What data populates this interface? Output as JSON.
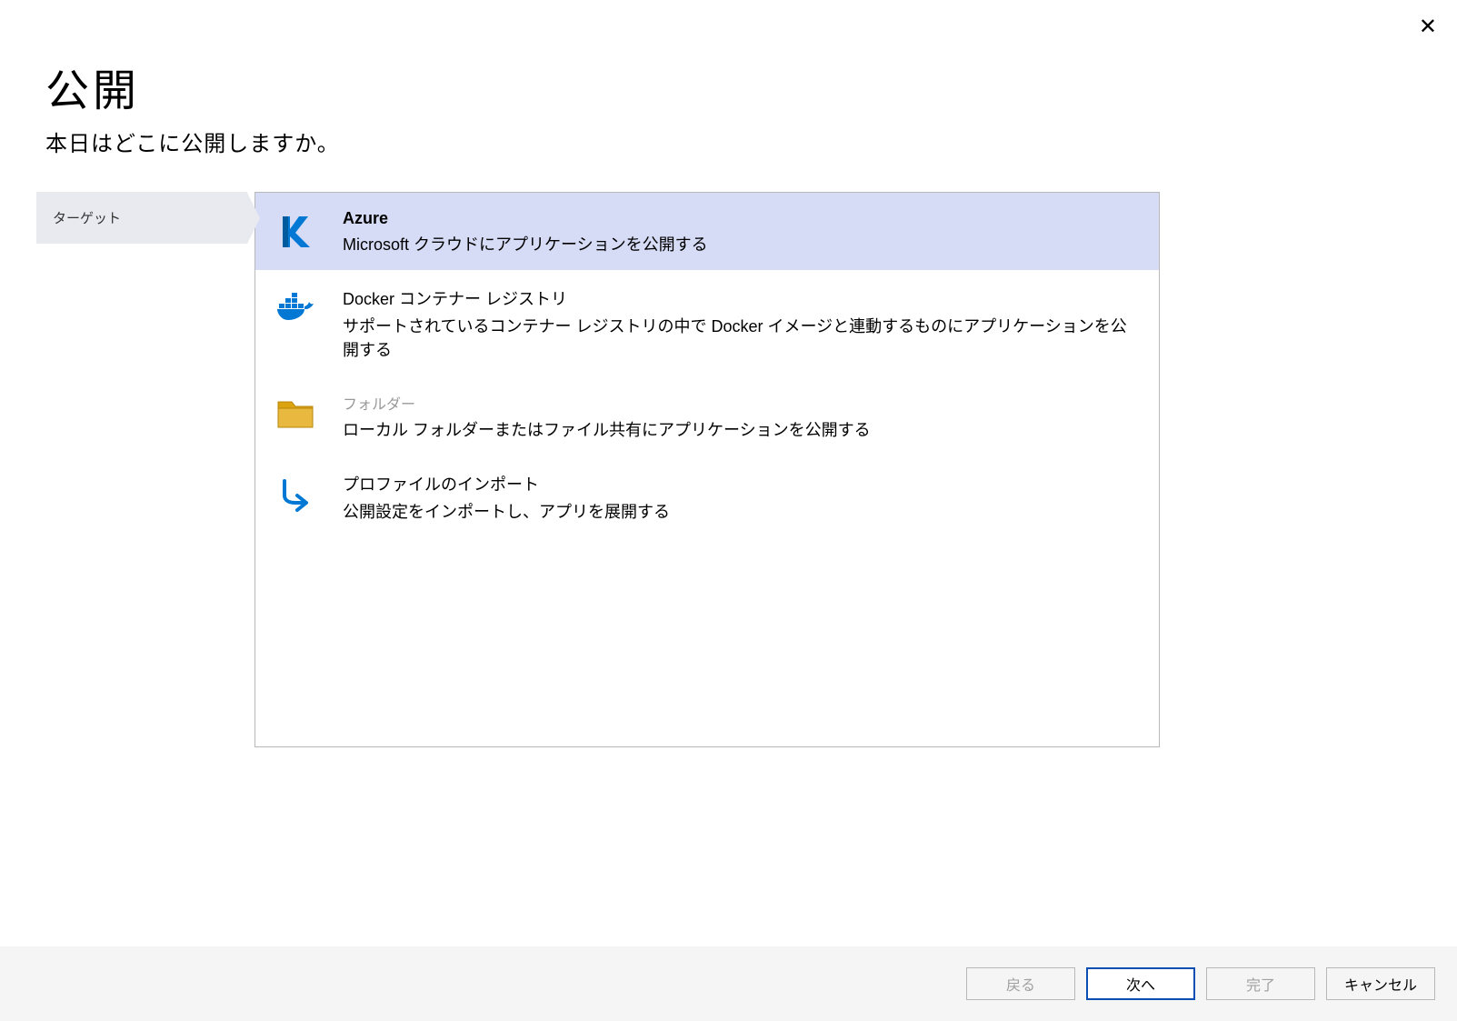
{
  "header": {
    "title": "公開",
    "subtitle": "本日はどこに公開しますか。"
  },
  "sidebar": {
    "items": [
      {
        "label": "ターゲット",
        "active": true
      }
    ]
  },
  "options": [
    {
      "id": "azure",
      "title": "Azure",
      "description": "Microsoft クラウドにアプリケーションを公開する",
      "selected": true
    },
    {
      "id": "docker",
      "title": "Docker コンテナー レジストリ",
      "description": "サポートされているコンテナー レジストリの中で Docker イメージと連動するものにアプリケーションを公開する",
      "selected": false
    },
    {
      "id": "folder",
      "title": "フォルダー",
      "description": "ローカル フォルダーまたはファイル共有にアプリケーションを公開する",
      "selected": false,
      "disabled_title": true
    },
    {
      "id": "import",
      "title": "プロファイルのインポート",
      "description": "公開設定をインポートし、アプリを展開する",
      "selected": false
    }
  ],
  "footer": {
    "back": "戻る",
    "next": "次へ",
    "finish": "完了",
    "cancel": "キャンセル"
  }
}
